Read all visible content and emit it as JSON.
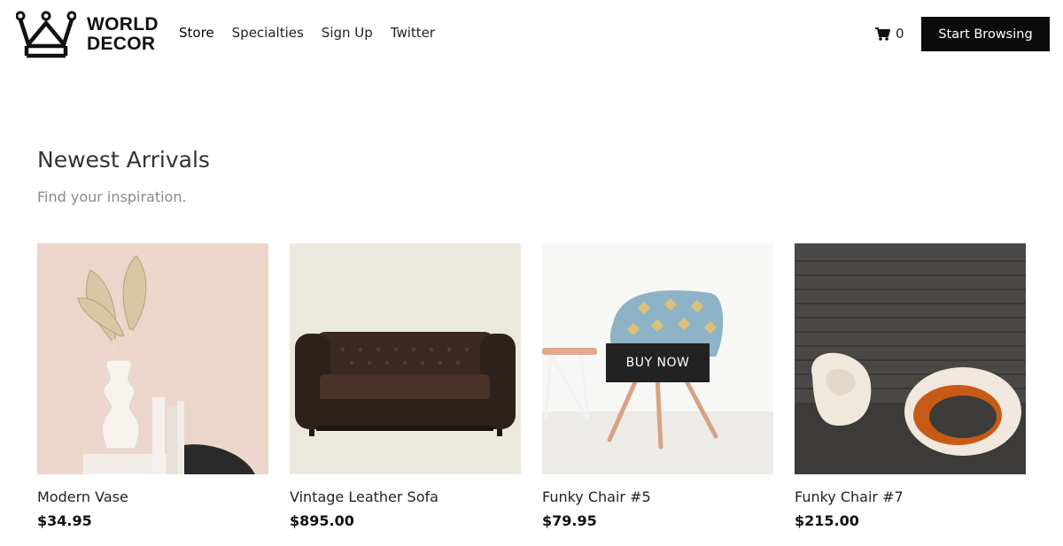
{
  "brand": {
    "line1": "WORLD",
    "line2": "DECOR"
  },
  "nav": {
    "items": [
      "Store",
      "Specialties",
      "Sign Up",
      "Twitter"
    ]
  },
  "cart": {
    "count": "0"
  },
  "header": {
    "cta_label": "Start Browsing"
  },
  "section": {
    "title": "Newest Arrivals",
    "subtitle": "Find your inspiration."
  },
  "products": [
    {
      "name": "Modern Vase",
      "price": "$34.95"
    },
    {
      "name": "Vintage Leather Sofa",
      "price": "$895.00"
    },
    {
      "name": "Funky Chair #5",
      "price": "$79.95",
      "overlay": "BUY NOW"
    },
    {
      "name": "Funky Chair #7",
      "price": "$215.00"
    }
  ],
  "icons": {
    "logo": "crown-icon",
    "cart": "cart-icon"
  },
  "colors": {
    "cta_bg": "#0b0b0b",
    "overlay_bg": "#222222",
    "subtitle": "#8a8a8a"
  }
}
